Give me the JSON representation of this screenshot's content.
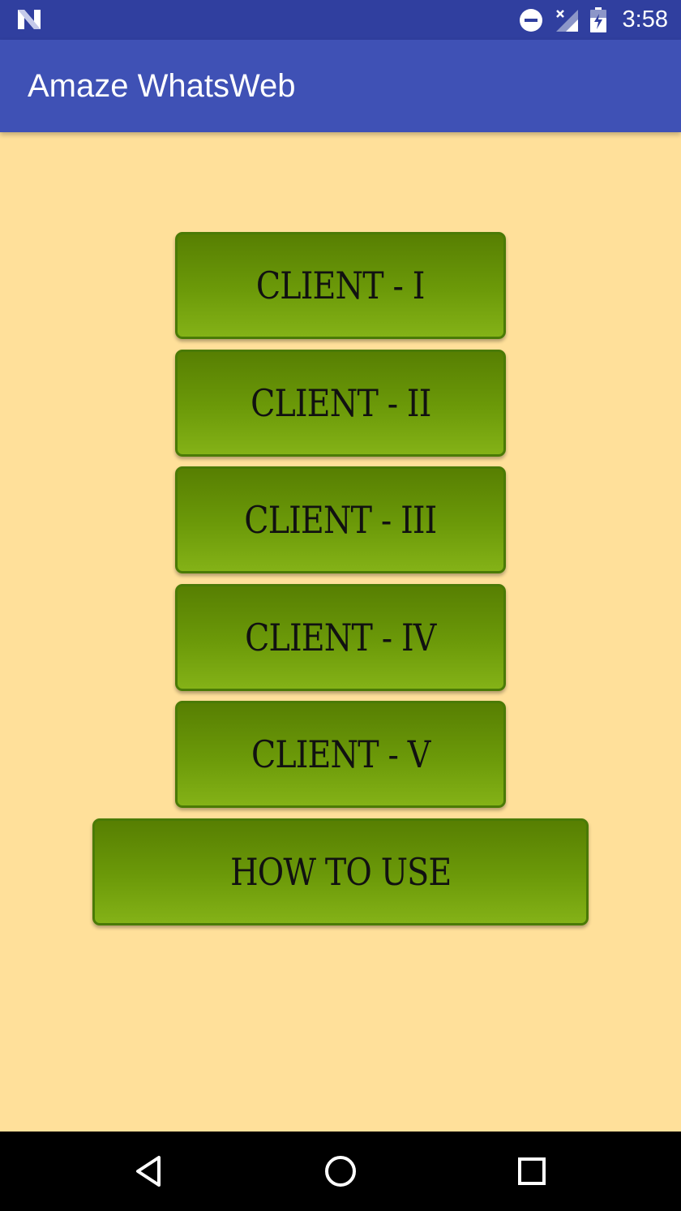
{
  "status_bar": {
    "time": "3:58",
    "icons": [
      "n-logo-icon",
      "do-not-disturb-icon",
      "no-signal-icon",
      "battery-charging-icon"
    ]
  },
  "app_bar": {
    "title": "Amaze WhatsWeb"
  },
  "buttons": [
    {
      "label": "CLIENT - I"
    },
    {
      "label": "CLIENT - II"
    },
    {
      "label": "CLIENT - III"
    },
    {
      "label": "CLIENT - IV"
    },
    {
      "label": "CLIENT - V"
    },
    {
      "label": "HOW TO USE"
    }
  ],
  "nav_bar": {
    "icons": [
      "back-icon",
      "home-icon",
      "recents-icon"
    ]
  },
  "colors": {
    "status_bar": "#303F9F",
    "app_bar": "#3F51B5",
    "background": "#FFE09A",
    "button_green_top": "#577F02",
    "button_green_bottom": "#84B217"
  }
}
